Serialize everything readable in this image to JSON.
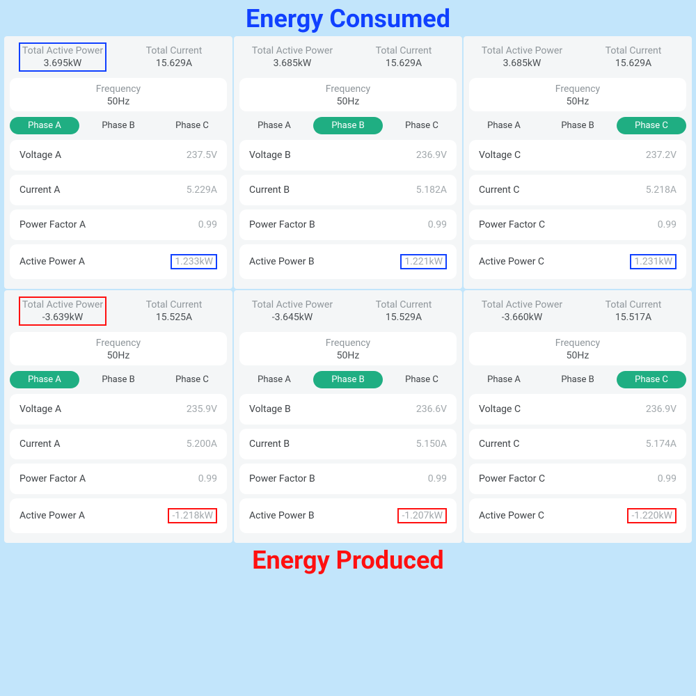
{
  "titles": {
    "top": "Energy Consumed",
    "bottom": "Energy Produced"
  },
  "labels": {
    "totalActivePower": "Total Active Power",
    "totalCurrent": "Total Current",
    "frequency": "Frequency",
    "phaseA": "Phase A",
    "phaseB": "Phase B",
    "phaseC": "Phase C"
  },
  "cards": [
    {
      "totalActivePower": "3.695kW",
      "totalCurrent": "15.629A",
      "frequency": "50Hz",
      "activePhase": "A",
      "highlightTotal": "blue",
      "highlightLast": "blue",
      "rows": [
        {
          "label": "Voltage A",
          "value": "237.5V"
        },
        {
          "label": "Current A",
          "value": "5.229A"
        },
        {
          "label": "Power Factor A",
          "value": "0.99"
        },
        {
          "label": "Active Power A",
          "value": "1.233kW"
        }
      ]
    },
    {
      "totalActivePower": "3.685kW",
      "totalCurrent": "15.629A",
      "frequency": "50Hz",
      "activePhase": "B",
      "highlightTotal": "none",
      "highlightLast": "blue",
      "rows": [
        {
          "label": "Voltage B",
          "value": "236.9V"
        },
        {
          "label": "Current B",
          "value": "5.182A"
        },
        {
          "label": "Power Factor B",
          "value": "0.99"
        },
        {
          "label": "Active Power B",
          "value": "1.221kW"
        }
      ]
    },
    {
      "totalActivePower": "3.685kW",
      "totalCurrent": "15.629A",
      "frequency": "50Hz",
      "activePhase": "C",
      "highlightTotal": "none",
      "highlightLast": "blue",
      "rows": [
        {
          "label": "Voltage C",
          "value": "237.2V"
        },
        {
          "label": "Current C",
          "value": "5.218A"
        },
        {
          "label": "Power Factor C",
          "value": "0.99"
        },
        {
          "label": "Active Power C",
          "value": "1.231kW"
        }
      ]
    },
    {
      "totalActivePower": "-3.639kW",
      "totalCurrent": "15.525A",
      "frequency": "50Hz",
      "activePhase": "A",
      "highlightTotal": "red",
      "highlightLast": "red",
      "rows": [
        {
          "label": "Voltage A",
          "value": "235.9V"
        },
        {
          "label": "Current A",
          "value": "5.200A"
        },
        {
          "label": "Power Factor A",
          "value": "0.99"
        },
        {
          "label": "Active Power A",
          "value": "-1.218kW"
        }
      ]
    },
    {
      "totalActivePower": "-3.645kW",
      "totalCurrent": "15.529A",
      "frequency": "50Hz",
      "activePhase": "B",
      "highlightTotal": "none",
      "highlightLast": "red",
      "rows": [
        {
          "label": "Voltage B",
          "value": "236.6V"
        },
        {
          "label": "Current B",
          "value": "5.150A"
        },
        {
          "label": "Power Factor B",
          "value": "0.99"
        },
        {
          "label": "Active Power B",
          "value": "-1.207kW"
        }
      ]
    },
    {
      "totalActivePower": "-3.660kW",
      "totalCurrent": "15.517A",
      "frequency": "50Hz",
      "activePhase": "C",
      "highlightTotal": "none",
      "highlightLast": "red",
      "rows": [
        {
          "label": "Voltage C",
          "value": "236.9V"
        },
        {
          "label": "Current C",
          "value": "5.174A"
        },
        {
          "label": "Power Factor C",
          "value": "0.99"
        },
        {
          "label": "Active Power C",
          "value": "-1.220kW"
        }
      ]
    }
  ]
}
